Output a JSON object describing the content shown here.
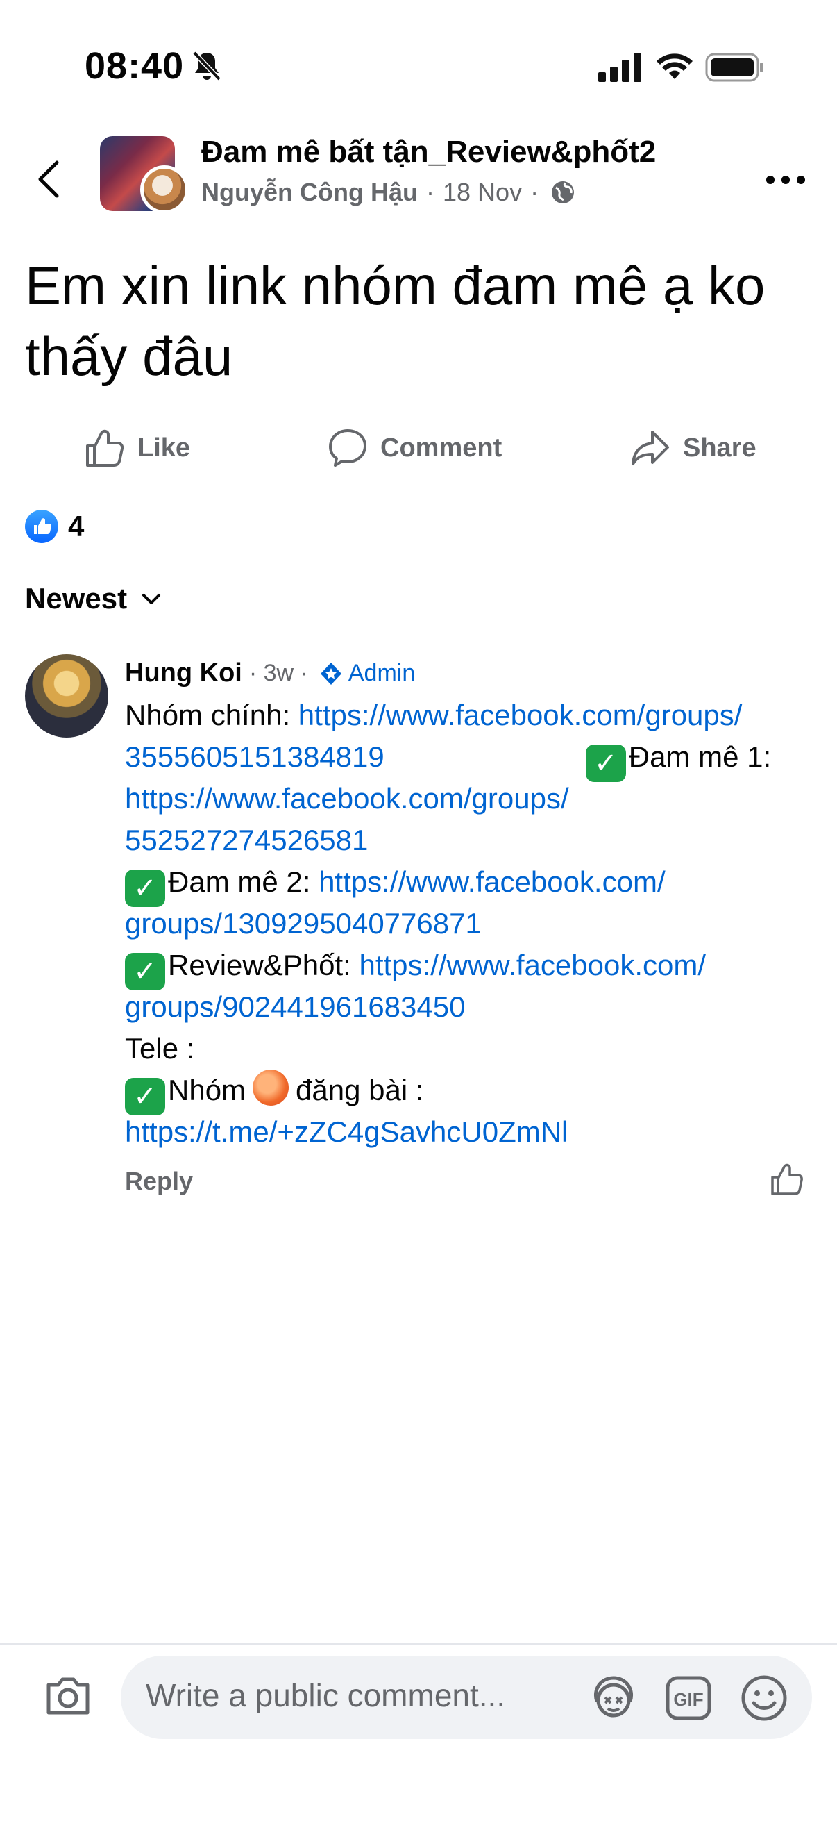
{
  "status_bar": {
    "time": "08:40"
  },
  "header": {
    "group_name": "Đam mê bất tận_Review&phốt2",
    "author": "Nguyễn Công Hậu",
    "date": "18 Nov",
    "separator": "·"
  },
  "post": {
    "title": "Em xin link nhóm đam mê ạ ko thấy đâu"
  },
  "actions": {
    "like": "Like",
    "comment": "Comment",
    "share": "Share"
  },
  "reactions": {
    "count": "4"
  },
  "sort": {
    "label": "Newest"
  },
  "comment": {
    "author": "Hung Koi",
    "time": "· 3w ·",
    "role": "Admin",
    "check_glyph": "✓",
    "lines": {
      "l1_text": "Nhóm chính: ",
      "l1_link": "https://www.facebook.com/groups/",
      "l2_link": "3555605151384819",
      "l2_text": "Đam mê 1:",
      "l3_link": "https://www.facebook.com/groups/",
      "l4_link": "552527274526581",
      "l5_text": "Đam mê 2: ",
      "l5_link": "https://www.facebook.com/",
      "l6_link": "groups/1309295040776871",
      "l7_text": "Review&Phốt: ",
      "l7_link": "https://www.facebook.com/",
      "l8_link": "groups/902441961683450",
      "l9_text": "Tele :",
      "l10_text_a": "Nhóm",
      "l10_text_b": "đăng bài :",
      "l11_link": "https://t.me/+zZC4gSavhcU0ZmNl"
    },
    "reply": "Reply"
  },
  "composer": {
    "placeholder": "Write a public comment..."
  },
  "colors": {
    "link": "#0064d1",
    "secondary_text": "#65676b",
    "like_blue": "#0866ff",
    "check_green": "#1ca34a"
  },
  "icons": {
    "back": "chevron-left-icon",
    "more": "more-horizontal-icon",
    "globe": "globe-icon",
    "like": "thumbs-up-icon",
    "comment": "comment-bubble-icon",
    "share": "share-arrow-icon",
    "camera": "camera-icon",
    "avatar_sticker": "avatar-sticker-icon",
    "gif": "gif-icon",
    "emoji": "emoji-icon"
  }
}
